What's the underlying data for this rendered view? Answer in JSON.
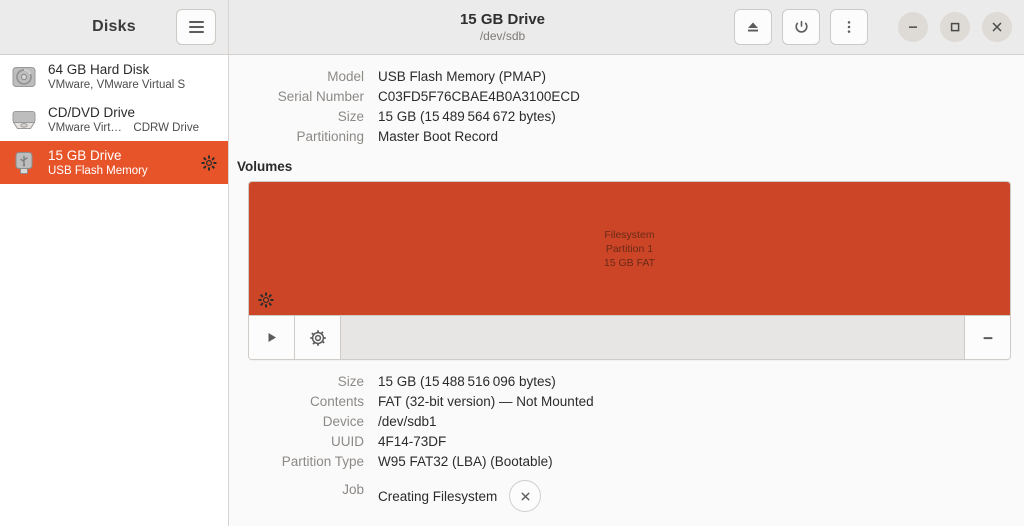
{
  "app": {
    "title": "Disks",
    "menu_icon": "hamburger-icon"
  },
  "header": {
    "drive_title": "15 GB Drive",
    "drive_device": "/dev/sdb",
    "buttons": [
      {
        "name": "eject-button",
        "icon": "eject-icon"
      },
      {
        "name": "power-button",
        "icon": "power-icon"
      },
      {
        "name": "more-options-button",
        "icon": "kebab-menu-icon"
      }
    ],
    "window_controls": [
      {
        "name": "minimize-button",
        "icon": "minimize-icon",
        "glyph": "–"
      },
      {
        "name": "maximize-button",
        "icon": "maximize-icon",
        "glyph": "□"
      },
      {
        "name": "close-button",
        "icon": "close-icon",
        "glyph": "×"
      }
    ]
  },
  "sidebar": {
    "items": [
      {
        "name": "64 GB Hard Disk",
        "subtitle": "VMware, VMware Virtual S",
        "icon": "hard-disk-icon",
        "selected": false,
        "busy": false
      },
      {
        "name": "CD/DVD Drive",
        "subtitle": "VMware Virt… CDRW Drive",
        "icon": "optical-drive-icon",
        "selected": false,
        "busy": false
      },
      {
        "name": "15 GB Drive",
        "subtitle": "USB Flash Memory",
        "icon": "usb-drive-icon",
        "selected": true,
        "busy": true
      }
    ]
  },
  "drive_info": {
    "rows": [
      {
        "label": "Model",
        "value": "USB Flash Memory (PMAP)"
      },
      {
        "label": "Serial Number",
        "value": "C03FD5F76CBAE4B0A3100ECD"
      },
      {
        "label": "Size",
        "value": "15 GB (15 489 564 672 bytes)"
      },
      {
        "label": "Partitioning",
        "value": "Master Boot Record"
      }
    ]
  },
  "volumes": {
    "section_title": "Volumes",
    "partition": {
      "line1": "Filesystem",
      "line2": "Partition 1",
      "line3": "15 GB FAT",
      "color": "#cb4526",
      "busy": true
    },
    "toolbar": [
      {
        "name": "mount-volume-button",
        "icon": "play-icon"
      },
      {
        "name": "volume-options-button",
        "icon": "gear-icon"
      },
      {
        "name": "delete-partition-button",
        "icon": "minus-icon"
      }
    ]
  },
  "partition_info": {
    "rows": [
      {
        "label": "Size",
        "value": "15 GB (15 488 516 096 bytes)"
      },
      {
        "label": "Contents",
        "value": "FAT (32-bit version) — Not Mounted"
      },
      {
        "label": "Device",
        "value": "/dev/sdb1"
      },
      {
        "label": "UUID",
        "value": "4F14-73DF"
      },
      {
        "label": "Partition Type",
        "value": "W95 FAT32 (LBA) (Bootable)"
      }
    ],
    "job": {
      "label": "Job",
      "value": "Creating Filesystem",
      "cancel_icon": "close-icon",
      "cancel_glyph": "×"
    }
  },
  "colors": {
    "accent": "#e8542a",
    "volume_fill": "#cb4526",
    "titlebar": "#ebebeb",
    "content_bg": "#fafafa"
  }
}
